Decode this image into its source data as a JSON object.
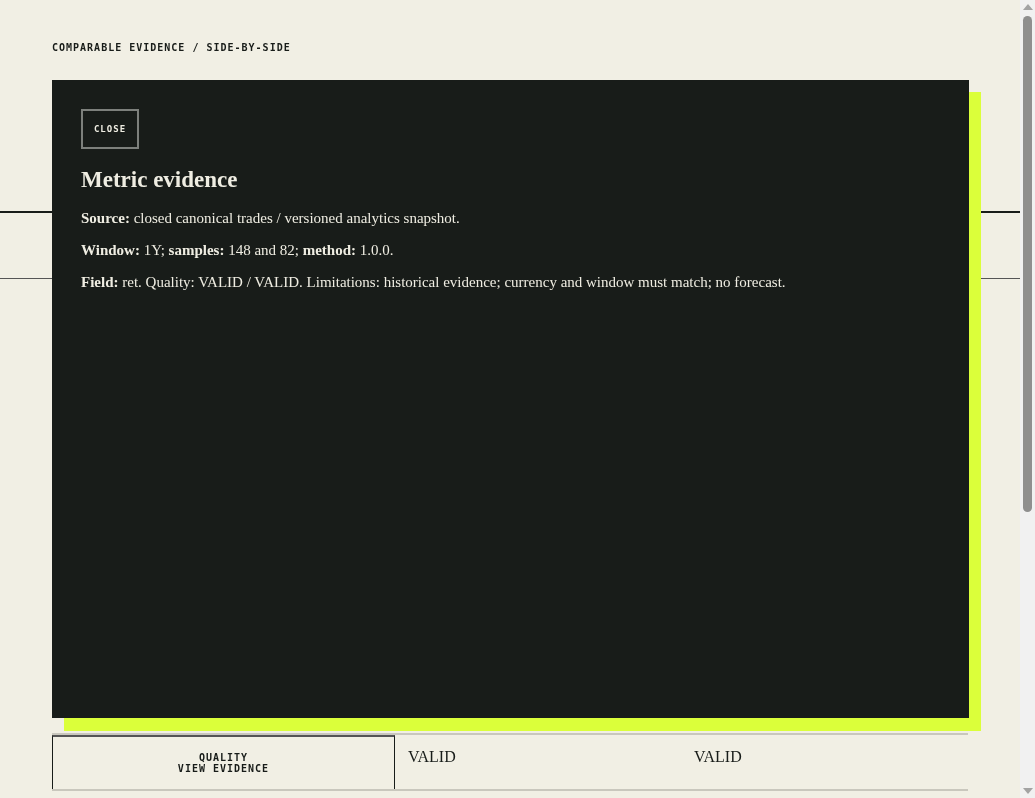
{
  "breadcrumb": "COMPARABLE EVIDENCE / SIDE-BY-SIDE",
  "table": {
    "rows": [
      {
        "label": "QUALITY",
        "link": "VIEW EVIDENCE",
        "values": [
          "VALID",
          "VALID"
        ]
      }
    ]
  },
  "modal": {
    "close": "CLOSE",
    "title": "Metric evidence",
    "paragraphs": [
      "**Source:** closed canonical trades / versioned analytics snapshot.",
      "**Window:** 1Y; **samples:** 148 and 82; **method:** 1.0.0.",
      "**Field:** ret. Quality: VALID / VALID. Limitations: historical evidence; currency and window must match; no forecast."
    ]
  }
}
